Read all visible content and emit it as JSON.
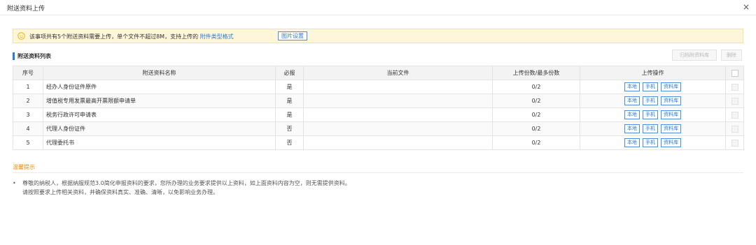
{
  "dialog": {
    "title": "附送资料上传",
    "close_icon": "×"
  },
  "notice": {
    "icon": "smile-icon",
    "text": "该事项共有5个附送资料需要上传，单个文件不超过8M，支持上传的 ",
    "link_text": "附件类型格式",
    "image_settings_label": "图片设置"
  },
  "list": {
    "title": "附送资料列表",
    "archive_button": "归档附资料库",
    "delete_button": "删除"
  },
  "table": {
    "headers": {
      "index": "序号",
      "name": "附送资料名称",
      "required": "必报",
      "current_file": "当前文件",
      "count": "上传份数/最多份数",
      "actions": "上传操作"
    },
    "action_labels": {
      "local": "本地",
      "phone": "手机",
      "library": "资料库"
    },
    "rows": [
      {
        "index": "1",
        "name": "经办人身份证件原件",
        "required": "是",
        "current_file": "",
        "count": "0/2"
      },
      {
        "index": "2",
        "name": "增值税专用发票最高开票限额申请单",
        "required": "是",
        "current_file": "",
        "count": "0/2"
      },
      {
        "index": "3",
        "name": "税务行政许可申请表",
        "required": "是",
        "current_file": "",
        "count": "0/2"
      },
      {
        "index": "4",
        "name": "代理人身份证件",
        "required": "否",
        "current_file": "",
        "count": "0/2"
      },
      {
        "index": "5",
        "name": "代理委托书",
        "required": "否",
        "current_file": "",
        "count": "0/2"
      }
    ]
  },
  "tips": {
    "title": "温馨提示",
    "bullet": "•",
    "line1": "尊敬的纳税人，根据纳服规范3.0简化申报资料的要求，您所办理的业务要求提供以上资料，如上面资料内容为空，则无需提供资料。",
    "line2": "请按照要求上传相关资料，并确保资料真实、准确、清晰，以免影响业务办理。"
  },
  "colors": {
    "accent": "#2e7bd6",
    "notice_bg": "#fdf6da",
    "tip_title": "#f08a00"
  }
}
